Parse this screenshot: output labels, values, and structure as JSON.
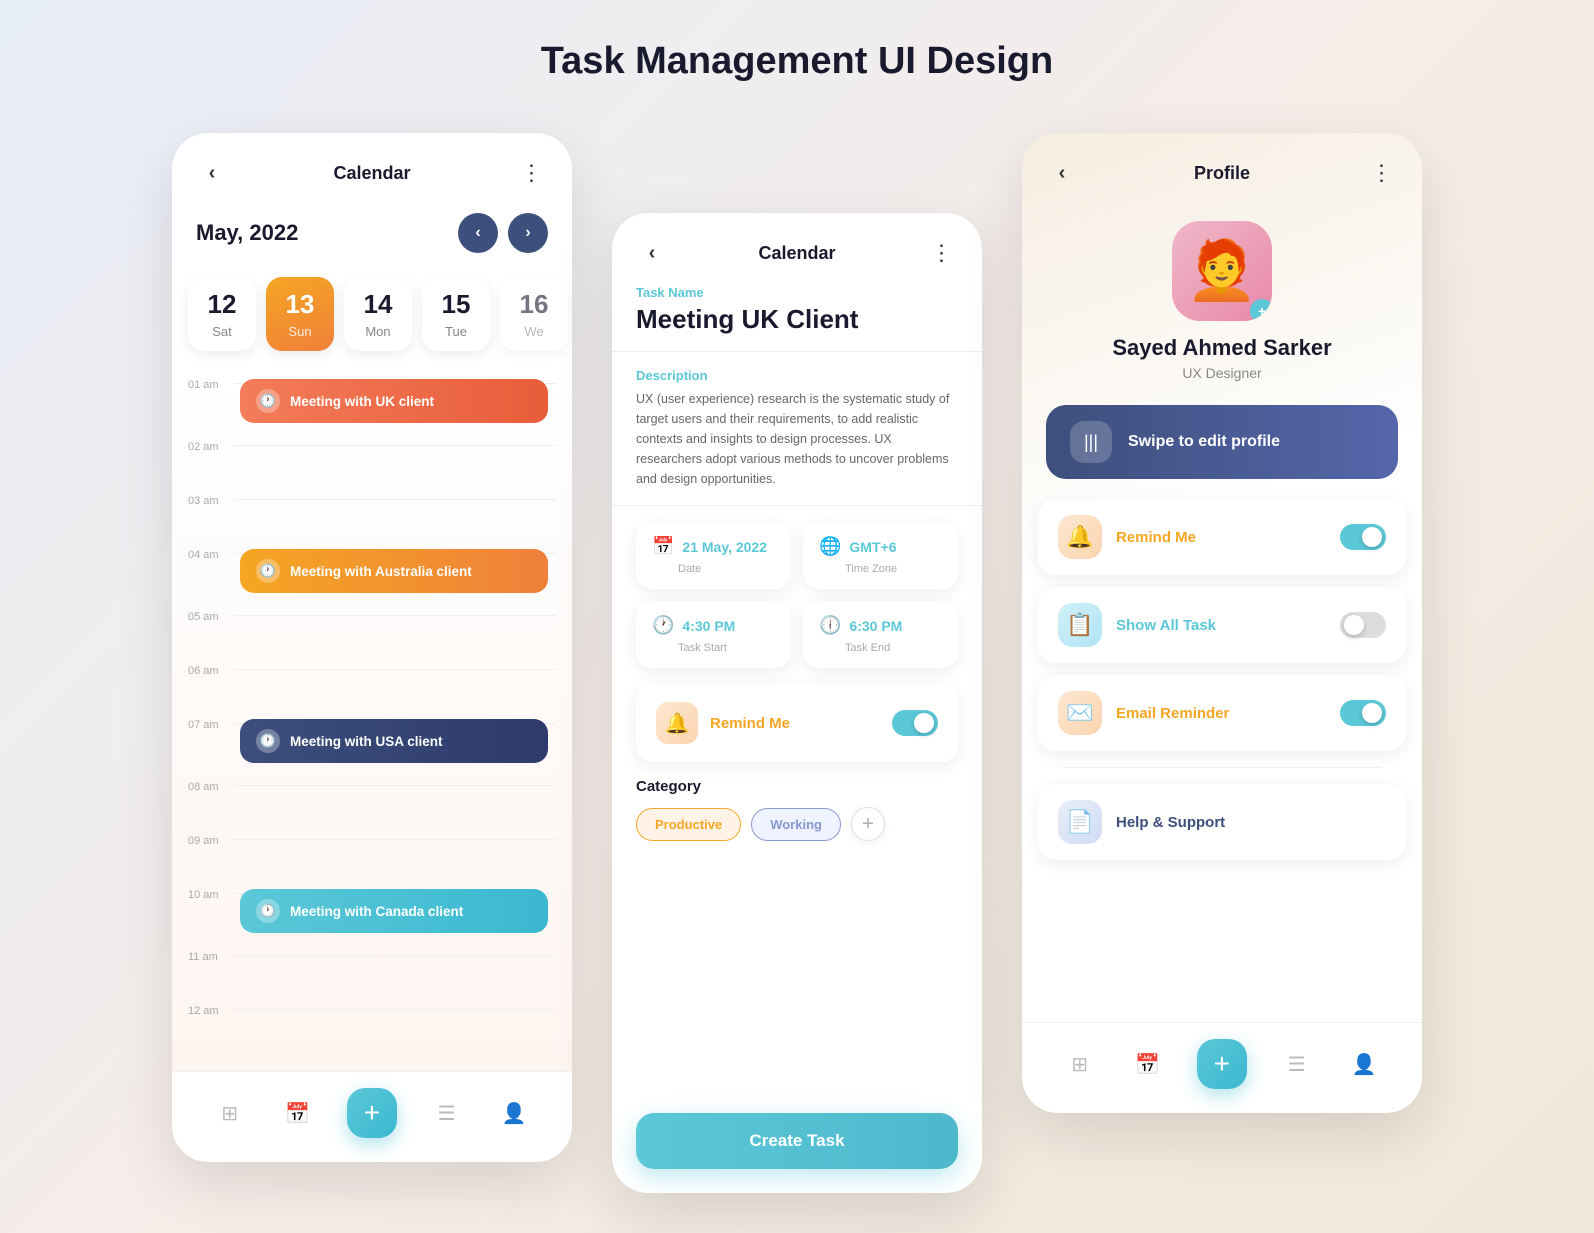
{
  "page": {
    "title": "Task Management UI Design"
  },
  "screen1": {
    "header": {
      "back": "‹",
      "title": "Calendar",
      "menu": "⋮"
    },
    "month": "May, 2022",
    "dates": [
      {
        "num": "12",
        "day": "Sat",
        "active": false
      },
      {
        "num": "13",
        "day": "Sun",
        "active": true
      },
      {
        "num": "14",
        "day": "Mon",
        "active": false
      },
      {
        "num": "15",
        "day": "Tue",
        "active": false
      },
      {
        "num": "16",
        "day": "We",
        "active": false,
        "partial": true
      }
    ],
    "events": [
      {
        "time": "01 am",
        "label": "Meeting with UK client",
        "color": "uk"
      },
      {
        "time": "04 am",
        "label": "Meeting with Australia client",
        "color": "aus"
      },
      {
        "time": "07 am",
        "label": "Meeting with USA client",
        "color": "usa"
      },
      {
        "time": "10 am",
        "label": "Meeting with Canada client",
        "color": "can"
      }
    ],
    "times": [
      "01 am",
      "02 am",
      "03 am",
      "04 am",
      "05 am",
      "06 am",
      "07 am",
      "08 am",
      "09 am",
      "10 am",
      "11 am",
      "12 am"
    ],
    "nav": {
      "add_label": "+"
    }
  },
  "screen2": {
    "header": {
      "back": "‹",
      "title": "Calendar",
      "menu": "⋮"
    },
    "task_name_label": "Task Name",
    "task_name": "Meeting UK Client",
    "description_label": "Description",
    "description": "UX (user experience) research is the systematic study of target users and their requirements, to add realistic contexts and insights to design processes. UX researchers adopt various methods to uncover problems and design opportunities.",
    "info_cards": [
      {
        "icon": "📅",
        "value": "21 May, 2022",
        "label": "Date"
      },
      {
        "icon": "🌐",
        "value": "GMT+6",
        "label": "Time Zone"
      },
      {
        "icon": "🕐",
        "value": "4:30 PM",
        "label": "Task Start"
      },
      {
        "icon": "🕕",
        "value": "6:30 PM",
        "label": "Task End"
      }
    ],
    "remind_me": {
      "label": "Remind Me",
      "icon": "🔔",
      "toggle": "on"
    },
    "category": {
      "label": "Category",
      "tags": [
        {
          "label": "Productive",
          "type": "productive"
        },
        {
          "label": "Working",
          "type": "working"
        }
      ],
      "add_icon": "+"
    },
    "create_task_btn": "Create Task"
  },
  "screen3": {
    "header": {
      "back": "‹",
      "title": "Profile",
      "menu": "⋮"
    },
    "avatar_emoji": "🧑",
    "name": "Sayed Ahmed Sarker",
    "role": "UX Designer",
    "swipe_label": "Swipe to edit profile",
    "swipe_icon": "|||",
    "menu_items": [
      {
        "icon": "🔔",
        "label": "Remind Me",
        "toggle": "on",
        "icon_type": "orange",
        "label_type": "orange"
      },
      {
        "icon": "📋",
        "label": "Show All Task",
        "toggle": "off",
        "icon_type": "blue",
        "label_type": "blue"
      },
      {
        "icon": "✉️",
        "label": "Email Reminder",
        "toggle": "on",
        "icon_type": "orange",
        "label_type": "orange"
      },
      {
        "icon": "📄",
        "label": "Help & Support",
        "toggle": null,
        "icon_type": "slate",
        "label_type": "slate"
      }
    ],
    "nav": {
      "add_label": "+"
    }
  }
}
